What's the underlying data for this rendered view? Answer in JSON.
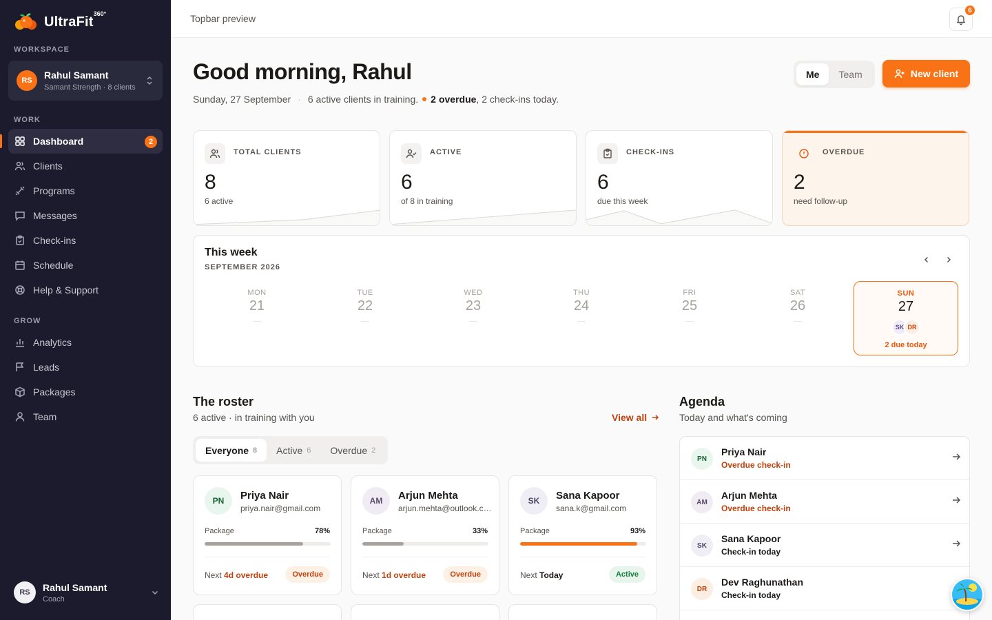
{
  "brand": {
    "name": "UltraFit",
    "sup": "360°"
  },
  "sidebar": {
    "workspace_label": "WORKSPACE",
    "workspace": {
      "initials": "RS",
      "name": "Rahul Samant",
      "sub": "Samant Strength · 8 clients"
    },
    "work_label": "WORK",
    "grow_label": "GROW",
    "work_items": [
      {
        "label": "Dashboard",
        "icon": "dashboard-icon",
        "badge": "2",
        "active": true
      },
      {
        "label": "Clients",
        "icon": "users-icon"
      },
      {
        "label": "Programs",
        "icon": "dumbbell-icon"
      },
      {
        "label": "Messages",
        "icon": "message-icon"
      },
      {
        "label": "Check-ins",
        "icon": "clipboard-check-icon"
      },
      {
        "label": "Schedule",
        "icon": "calendar-icon"
      },
      {
        "label": "Help & Support",
        "icon": "lifebuoy-icon"
      }
    ],
    "grow_items": [
      {
        "label": "Analytics",
        "icon": "bar-chart-icon"
      },
      {
        "label": "Leads",
        "icon": "flag-icon"
      },
      {
        "label": "Packages",
        "icon": "package-icon"
      },
      {
        "label": "Team",
        "icon": "team-icon"
      }
    ],
    "user": {
      "initials": "RS",
      "name": "Rahul Samant",
      "role": "Coach"
    }
  },
  "topbar": {
    "title": "Topbar preview",
    "notifications": "6"
  },
  "header": {
    "greeting": "Good morning, Rahul",
    "date": "Sunday, 27 September",
    "sep": "·",
    "active_text": "6 active clients in training.",
    "overdue_count": "2",
    "overdue_word": "overdue",
    "checkins_text": ", 2 check-ins today.",
    "scope_me": "Me",
    "scope_team": "Team",
    "new_client": "New client"
  },
  "stats": [
    {
      "label": "TOTAL CLIENTS",
      "value": "8",
      "sub": "6 active",
      "icon": "users-icon"
    },
    {
      "label": "ACTIVE",
      "value": "6",
      "sub": "of 8 in training",
      "icon": "user-check-icon"
    },
    {
      "label": "CHECK-INS",
      "value": "6",
      "sub": "due this week",
      "icon": "clipboard-check-icon"
    },
    {
      "label": "OVERDUE",
      "value": "2",
      "sub": "need follow-up",
      "icon": "alert-circle-icon"
    }
  ],
  "week": {
    "title": "This week",
    "month": "SEPTEMBER 2026",
    "days": [
      {
        "name": "MON",
        "num": "21"
      },
      {
        "name": "TUE",
        "num": "22"
      },
      {
        "name": "WED",
        "num": "23"
      },
      {
        "name": "THU",
        "num": "24"
      },
      {
        "name": "FRI",
        "num": "25"
      },
      {
        "name": "SAT",
        "num": "26"
      },
      {
        "name": "SUN",
        "num": "27",
        "today": true,
        "avatars": [
          "SK",
          "DR"
        ],
        "due": "2 due today"
      }
    ]
  },
  "roster": {
    "title": "The roster",
    "sub": "6 active · in training with you",
    "view_all": "View all",
    "tabs": [
      {
        "label": "Everyone",
        "count": "8",
        "on": true
      },
      {
        "label": "Active",
        "count": "6"
      },
      {
        "label": "Overdue",
        "count": "2"
      }
    ],
    "pkg_label": "Package",
    "next_label": "Next",
    "clients": [
      {
        "initials": "PN",
        "name": "Priya Nair",
        "email": "priya.nair@gmail.com",
        "pct": "78%",
        "progress": 0.78,
        "next": "4d overdue",
        "status": "Overdue"
      },
      {
        "initials": "AM",
        "name": "Arjun Mehta",
        "email": "arjun.mehta@outlook.com",
        "pct": "33%",
        "progress": 0.33,
        "next": "1d overdue",
        "status": "Overdue"
      },
      {
        "initials": "SK",
        "name": "Sana Kapoor",
        "email": "sana.k@gmail.com",
        "pct": "93%",
        "progress": 0.93,
        "next": "Today",
        "status": "Active"
      }
    ]
  },
  "agenda": {
    "title": "Agenda",
    "sub": "Today and what's coming",
    "items": [
      {
        "initials": "PN",
        "name": "Priya Nair",
        "status": "Overdue check-in"
      },
      {
        "initials": "AM",
        "name": "Arjun Mehta",
        "status": "Overdue check-in"
      },
      {
        "initials": "SK",
        "name": "Sana Kapoor",
        "status": "Check-in today"
      },
      {
        "initials": "DR",
        "name": "Dev Raghunathan",
        "status": "Check-in today"
      }
    ]
  },
  "colors": {
    "accent": "#f97316",
    "sidebar": "#1c1b2e",
    "overdue": "#c2410c",
    "active": "#15803d"
  }
}
